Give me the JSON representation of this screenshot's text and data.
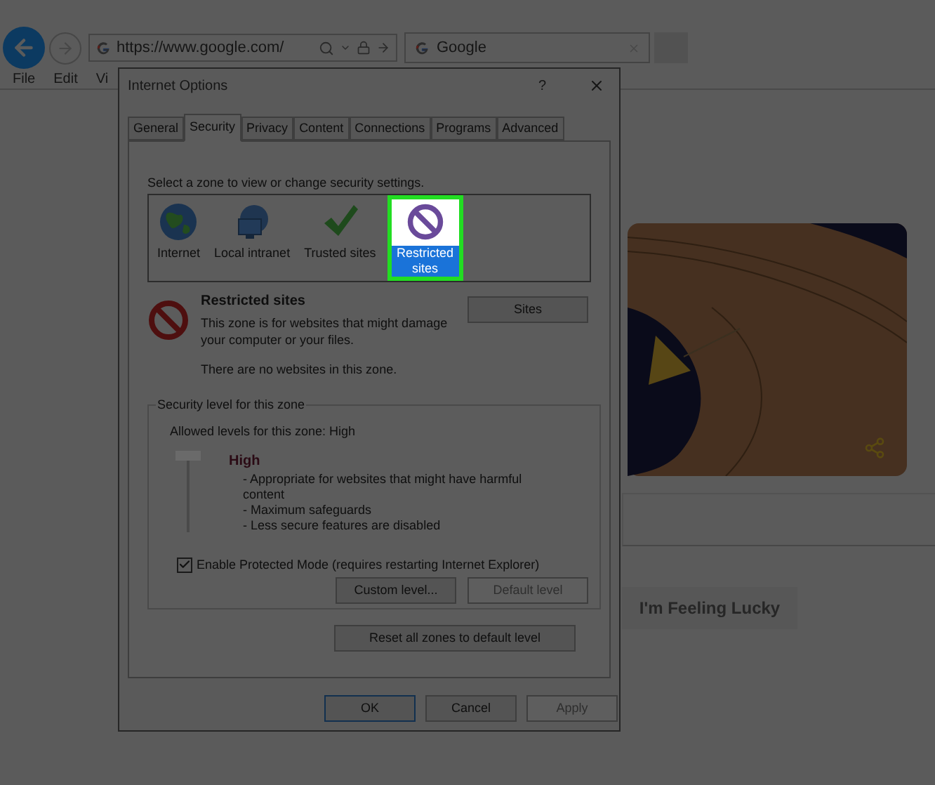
{
  "browser": {
    "address": "https://www.google.com/",
    "tab_title": "Google",
    "menu": [
      "File",
      "Edit",
      "Vi"
    ]
  },
  "google_page": {
    "lucky_button": "I'm Feeling Lucky"
  },
  "dialog": {
    "title": "Internet Options",
    "help": "?",
    "tabs": [
      {
        "label": "General",
        "selected": false
      },
      {
        "label": "Security",
        "selected": true
      },
      {
        "label": "Privacy",
        "selected": false
      },
      {
        "label": "Content",
        "selected": false
      },
      {
        "label": "Connections",
        "selected": false
      },
      {
        "label": "Programs",
        "selected": false
      },
      {
        "label": "Advanced",
        "selected": false
      }
    ],
    "zone_prompt": "Select a zone to view or change security settings.",
    "zones": [
      {
        "label": "Internet",
        "kind": "internet",
        "selected": false
      },
      {
        "label": "Local intranet",
        "kind": "intranet",
        "selected": false
      },
      {
        "label": "Trusted sites",
        "kind": "trusted",
        "selected": false
      },
      {
        "label": "Restricted sites",
        "kind": "restricted",
        "selected": true
      }
    ],
    "zone_info": {
      "title": "Restricted sites",
      "description": "This zone is for websites that might damage your computer or your files.",
      "sites_button": "Sites",
      "empty_note": "There are no websites in this zone."
    },
    "security_level": {
      "group_title": "Security level for this zone",
      "allowed": "Allowed levels for this zone: High",
      "slider": {
        "level": 1
      },
      "level_name": "High",
      "bullets": [
        "- Appropriate for websites that might have harmful content",
        "- Maximum safeguards",
        "- Less secure features are disabled"
      ],
      "protected_mode": {
        "label": "Enable Protected Mode (requires restarting Internet Explorer)",
        "checked": true
      },
      "buttons": [
        {
          "label": "Custom level...",
          "disabled": false
        },
        {
          "label": "Default level",
          "disabled": true
        }
      ]
    },
    "reset_button": "Reset all zones to default level",
    "buttons": [
      {
        "label": "OK",
        "disabled": false,
        "default": true
      },
      {
        "label": "Cancel",
        "disabled": false,
        "default": false
      },
      {
        "label": "Apply",
        "disabled": true,
        "default": false
      }
    ]
  }
}
